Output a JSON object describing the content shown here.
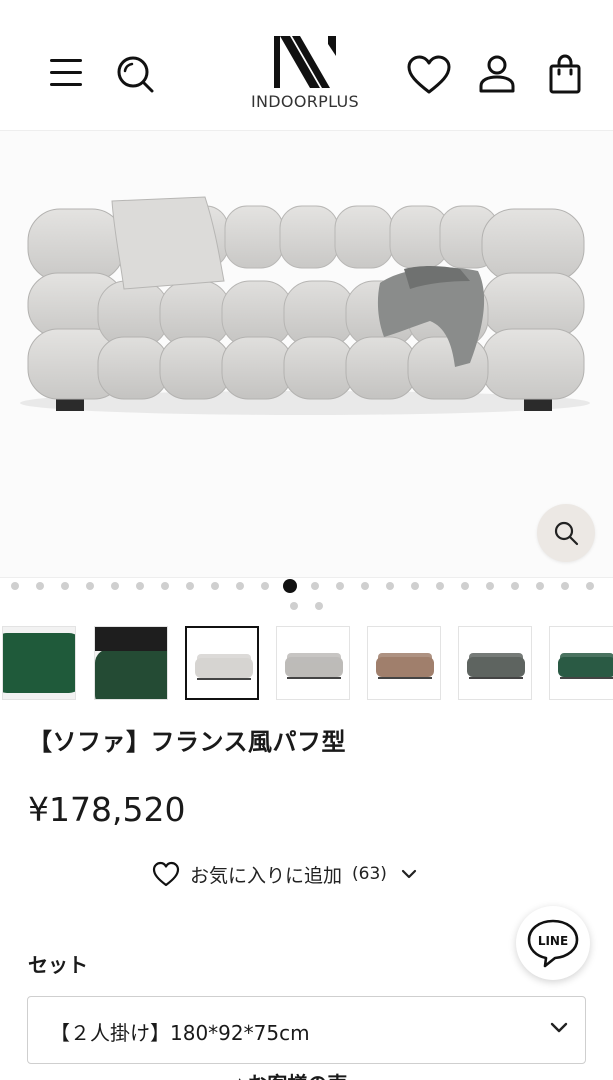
{
  "header": {
    "logo_text": "INDOORPLUS",
    "icons": [
      "menu-icon",
      "search-icon",
      "heart-icon",
      "user-icon",
      "bag-icon"
    ]
  },
  "hero": {
    "zoom_icon": "search-icon"
  },
  "carousel": {
    "total_slides": 26,
    "active_index": 11
  },
  "thumbnails": [
    {
      "name": "green-sofa-closeup",
      "color": "#1f5a3a"
    },
    {
      "name": "green-sofa-room",
      "color": "#244b34"
    },
    {
      "name": "light-gray-sofa",
      "color": "#d6d4d1",
      "selected": true
    },
    {
      "name": "gray-sofa",
      "color": "#bdbbb8"
    },
    {
      "name": "brown-sofa",
      "color": "#a07f6c"
    },
    {
      "name": "dark-gray-sofa",
      "color": "#5e6460"
    },
    {
      "name": "green-sofa-partial",
      "color": "#2a5a44"
    }
  ],
  "product": {
    "title": "【ソファ】フランス風パフ型",
    "price": "¥178,520",
    "favorite_label": "お気に入りに追加",
    "favorite_count": "(63)"
  },
  "options": {
    "set_label": "セット",
    "selected_value": "【２人掛け】180*92*75cm"
  },
  "line_button": {
    "label": "LINE"
  },
  "footer_cut_text": "▲お客様の声"
}
